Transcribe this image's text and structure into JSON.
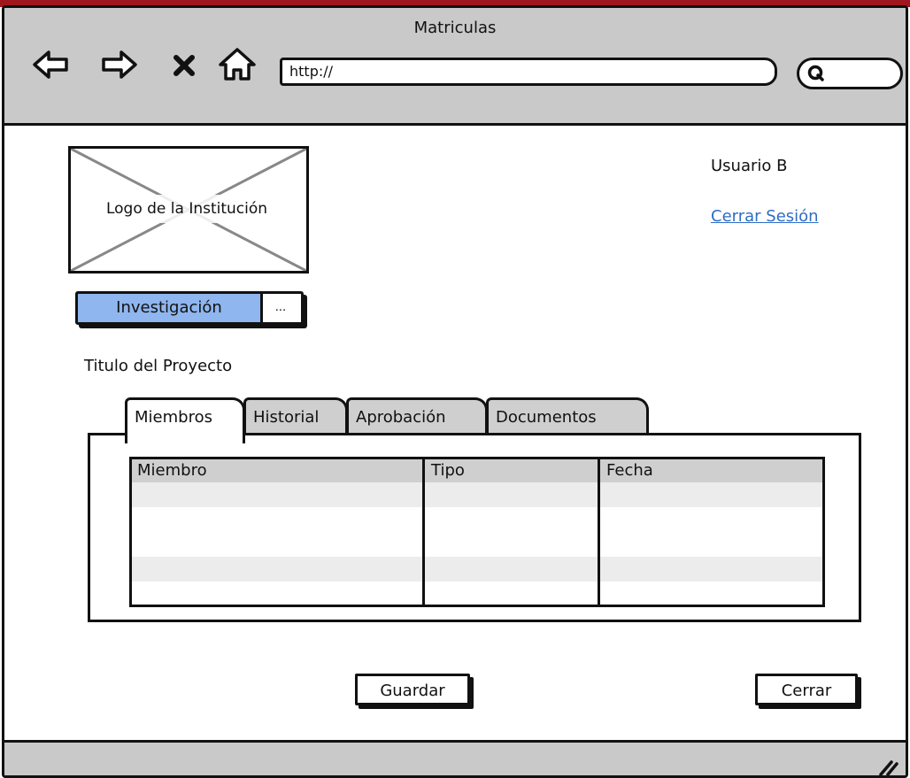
{
  "window": {
    "title": "Matriculas",
    "url": "http://",
    "search_placeholder": ""
  },
  "header": {
    "logo_label": "Logo de la Institución",
    "user_name": "Usuario B",
    "logout_label": "Cerrar Sesión"
  },
  "module_button": {
    "label": "Investigación",
    "more_label": "..."
  },
  "project": {
    "title": "Titulo del Proyecto"
  },
  "tabs": [
    {
      "label": "Miembros",
      "active": true
    },
    {
      "label": "Historial",
      "active": false
    },
    {
      "label": "Aprobación",
      "active": false
    },
    {
      "label": "Documentos",
      "active": false
    }
  ],
  "members_table": {
    "columns": [
      "Miembro",
      "Tipo",
      "Fecha"
    ],
    "rows": [
      [
        "",
        "",
        ""
      ],
      [
        "",
        "",
        ""
      ],
      [
        "",
        "",
        ""
      ],
      [
        "",
        "",
        ""
      ],
      [
        "",
        "",
        ""
      ]
    ]
  },
  "actions": {
    "save_label": "Guardar",
    "close_label": "Cerrar"
  },
  "colors": {
    "chrome": "#c9c9c9",
    "accent_button": "#8fb6ee",
    "link": "#2f6cc4",
    "title_bar_strip": "#a0161d"
  }
}
